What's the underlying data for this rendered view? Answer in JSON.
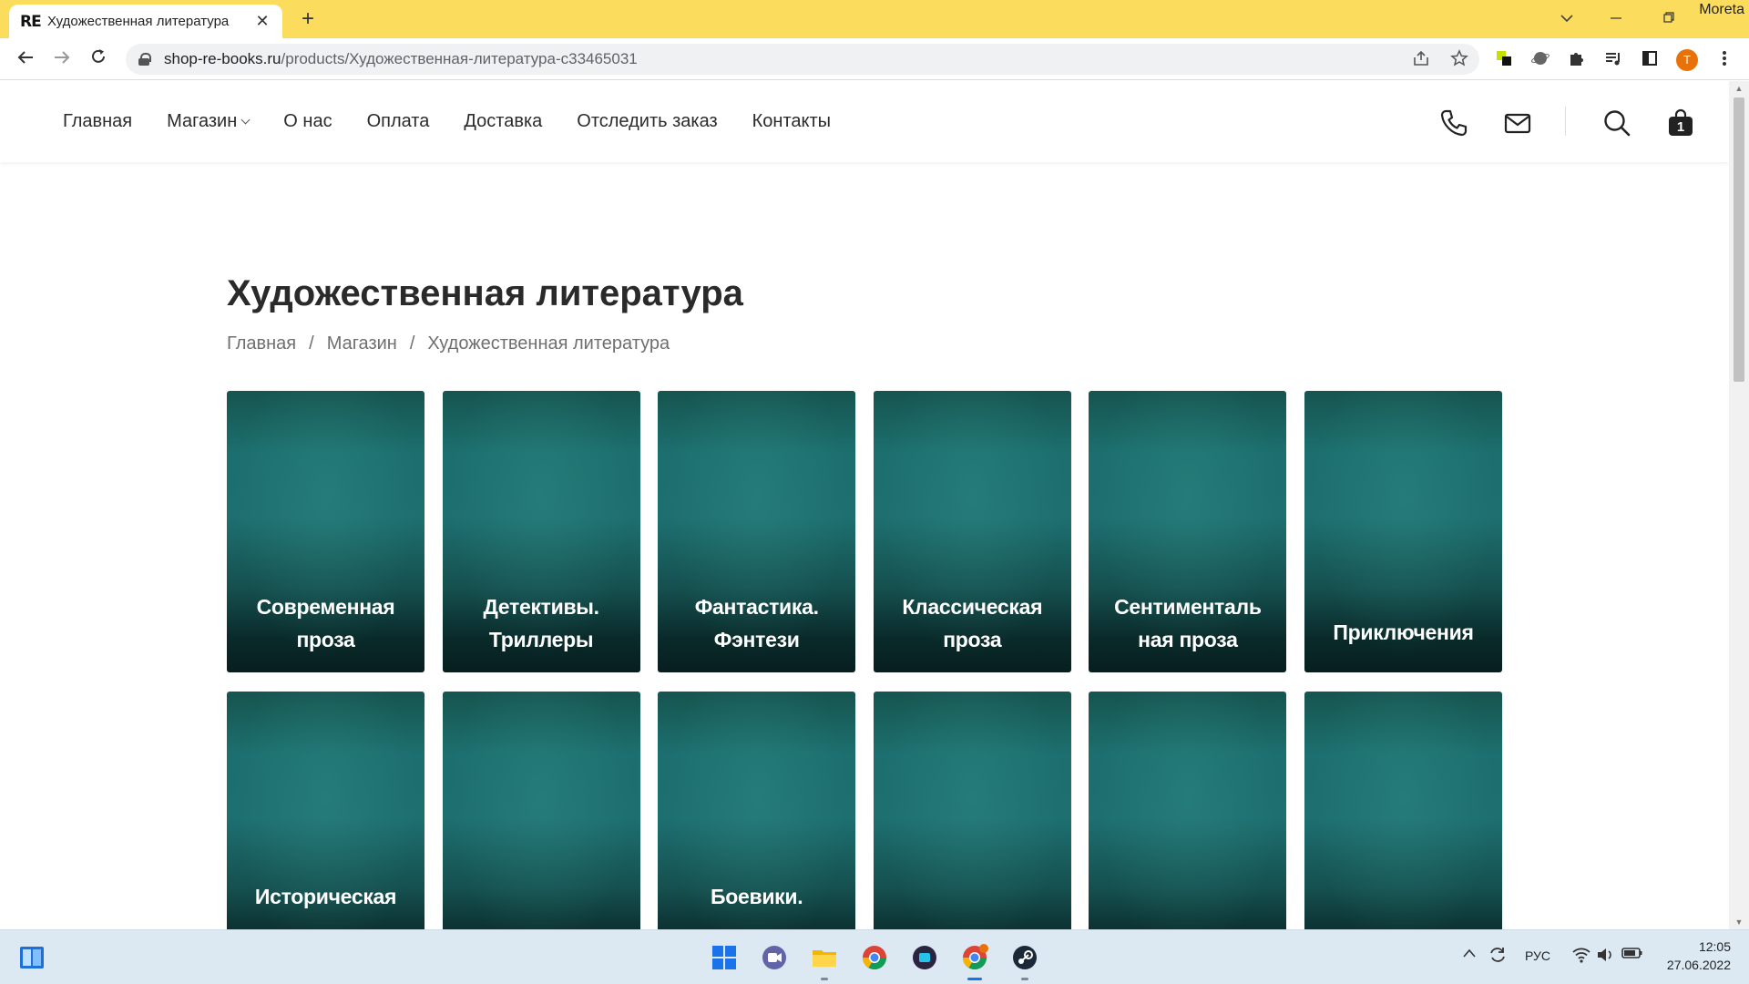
{
  "browser": {
    "tab_favicon": "RE",
    "tab_title": "Художественная литература",
    "tab_close": "✕",
    "new_tab": "+",
    "profile_name": "Moreta",
    "url_domain": "shop-re-books.ru",
    "url_path": "/products/Художественная-литература-с33465031",
    "avatar_letter": "T",
    "accent_color": "#fcdc5d"
  },
  "site_nav": {
    "items": [
      {
        "label": "Главная"
      },
      {
        "label": "Магазин"
      },
      {
        "label": "О нас"
      },
      {
        "label": "Оплата"
      },
      {
        "label": "Доставка"
      },
      {
        "label": "Отследить заказ"
      },
      {
        "label": "Контакты"
      }
    ],
    "cart_count": "1"
  },
  "page": {
    "title": "Художественная литература",
    "breadcrumb": [
      {
        "label": "Главная"
      },
      {
        "label": "Магазин"
      },
      {
        "label": "Художественная литература"
      }
    ],
    "breadcrumb_sep": "/"
  },
  "categories": [
    {
      "label": "Современная проза"
    },
    {
      "label": "Детективы. Триллеры"
    },
    {
      "label": "Фантастика. Фэнтези"
    },
    {
      "label": "Классическая проза"
    },
    {
      "label": "Сентименталь ная проза"
    },
    {
      "label": "Приключения"
    },
    {
      "label": "Историческая"
    },
    {
      "label": ""
    },
    {
      "label": "Боевики."
    },
    {
      "label": ""
    },
    {
      "label": ""
    },
    {
      "label": ""
    }
  ],
  "taskbar": {
    "language": "РУС",
    "time": "12:05",
    "date": "27.06.2022"
  }
}
